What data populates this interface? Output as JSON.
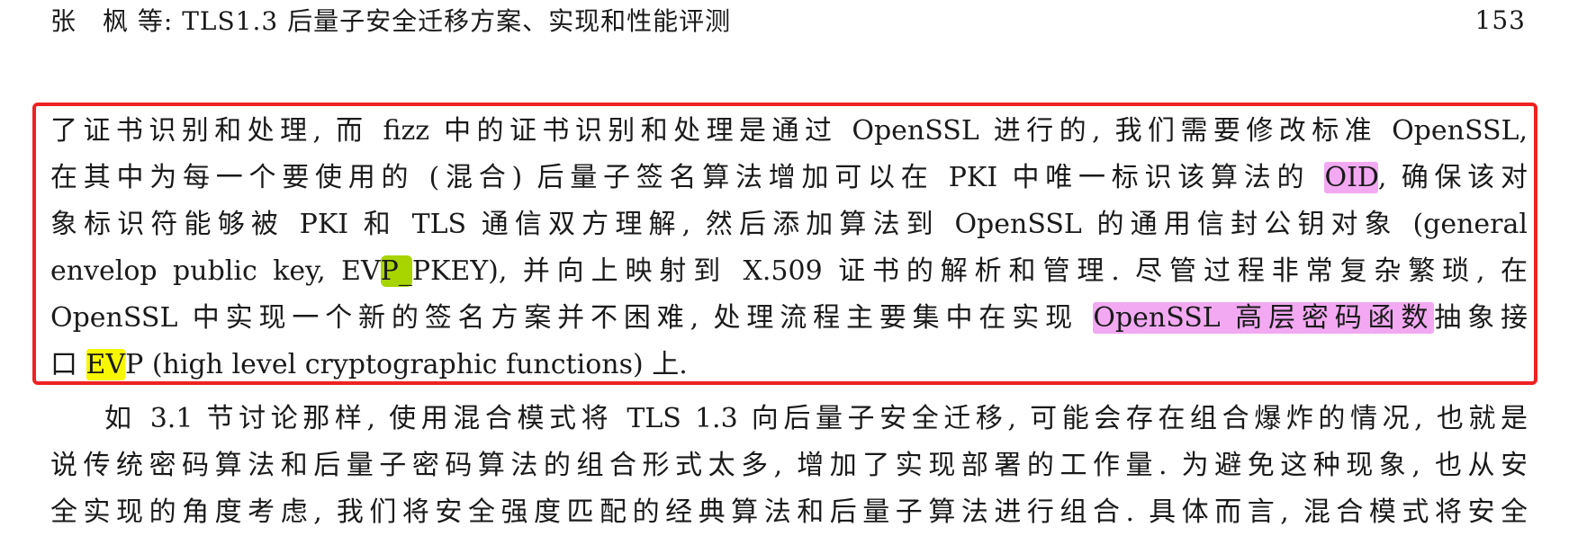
{
  "header": {
    "title": "张　枫 等: TLS1.3 后量子安全迁移方案、实现和性能评测",
    "page_number": "153"
  },
  "paragraph1": {
    "l1": "了证书识别和处理, 而 fizz 中的证书识别和处理是通过 OpenSSL 进行的, 我们需要修改标准 OpenSSL,",
    "l2_a": "在其中为每一个要使用的 (混合) 后量子签名算法增加可以在 PKI 中唯一标识该算法的 ",
    "l2_hl": "OID",
    "l2_b": ", 确保该对",
    "l3": "象标识符能够被 PKI 和 TLS 通信双方理解, 然后添加算法到 OpenSSL 的通用信封公钥对象 (general",
    "l4_a": "envelop public key, EV",
    "l4_hl": "P_",
    "l4_b": "PKEY), 并向上映射到 X.509 证书的解析和管理. 尽管过程非常复杂繁琐, 在",
    "l5_a": "OpenSSL 中实现一个新的签名方案并不困难, 处理流程主要集中在实现 ",
    "l5_hl": "OpenSSL 高层密码函数",
    "l5_b": "抽象接",
    "l6_a": "口 ",
    "l6_hl": "EV",
    "l6_b": "P (high level cryptographic functions) 上."
  },
  "paragraph2": {
    "l1": "如 3.1 节讨论那样, 使用混合模式将 TLS 1.3 向后量子安全迁移, 可能会存在组合爆炸的情况, 也就是",
    "l2": "说传统密码算法和后量子密码算法的组合形式太多, 增加了实现部署的工作量. 为避免这种现象, 也从安",
    "l3": "全实现的角度考虑, 我们将安全强度匹配的经典算法和后量子算法进行组合. 具体而言, 混合模式将安全"
  },
  "colors": {
    "highlight_pink": "#f2a9f2",
    "highlight_yellow": "#f7f700",
    "highlight_green": "#a8d400",
    "annotation_box": "#ee2222"
  }
}
